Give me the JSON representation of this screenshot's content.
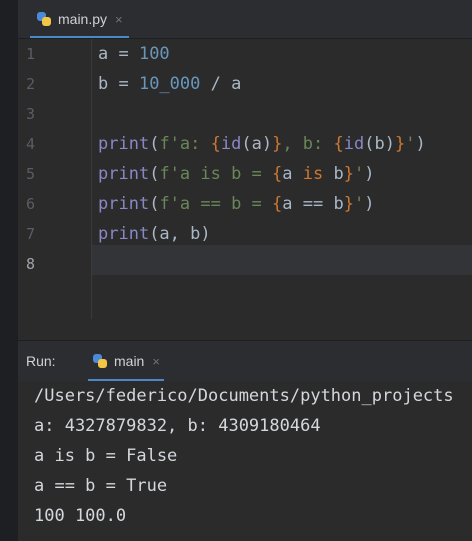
{
  "tab": {
    "filename": "main.py",
    "close": "×",
    "icon": "python-file-icon"
  },
  "editor": {
    "line_numbers": [
      "1",
      "2",
      "3",
      "4",
      "5",
      "6",
      "7",
      "8"
    ],
    "lines": [
      [
        [
          "a = ",
          "c-id"
        ],
        [
          "100",
          "c-num"
        ]
      ],
      [
        [
          "b = ",
          "c-id"
        ],
        [
          "10_000",
          "c-num"
        ],
        [
          " / a",
          "c-id"
        ]
      ],
      [],
      [
        [
          "print",
          "c-builtin"
        ],
        [
          "(",
          "c-id"
        ],
        [
          "f'a: ",
          "c-str"
        ],
        [
          "{",
          "c-brace"
        ],
        [
          "id",
          "c-builtin"
        ],
        [
          "(a)",
          "c-id"
        ],
        [
          "}",
          "c-brace"
        ],
        [
          ", b: ",
          "c-str"
        ],
        [
          "{",
          "c-brace"
        ],
        [
          "id",
          "c-builtin"
        ],
        [
          "(b)",
          "c-id"
        ],
        [
          "}",
          "c-brace"
        ],
        [
          "'",
          "c-str"
        ],
        [
          ")",
          "c-id"
        ]
      ],
      [
        [
          "print",
          "c-builtin"
        ],
        [
          "(",
          "c-id"
        ],
        [
          "f'a is b = ",
          "c-str"
        ],
        [
          "{",
          "c-brace"
        ],
        [
          "a ",
          "c-id"
        ],
        [
          "is",
          "c-kw"
        ],
        [
          " b",
          "c-id"
        ],
        [
          "}",
          "c-brace"
        ],
        [
          "'",
          "c-str"
        ],
        [
          ")",
          "c-id"
        ]
      ],
      [
        [
          "print",
          "c-builtin"
        ],
        [
          "(",
          "c-id"
        ],
        [
          "f'a == b = ",
          "c-str"
        ],
        [
          "{",
          "c-brace"
        ],
        [
          "a == b",
          "c-id"
        ],
        [
          "}",
          "c-brace"
        ],
        [
          "'",
          "c-str"
        ],
        [
          ")",
          "c-id"
        ]
      ],
      [
        [
          "print",
          "c-builtin"
        ],
        [
          "(a, b)",
          "c-id"
        ]
      ],
      []
    ]
  },
  "run": {
    "label": "Run:",
    "config_name": "main",
    "close": "×",
    "output": [
      "/Users/federico/Documents/python_projects",
      "a: 4327879832, b: 4309180464",
      "a is b = False",
      "a == b = True",
      "100 100.0"
    ]
  }
}
